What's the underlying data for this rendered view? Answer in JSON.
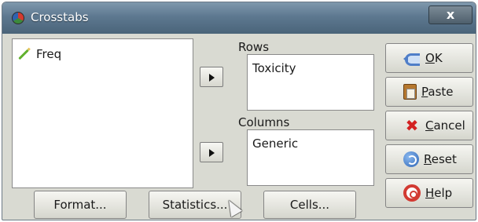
{
  "window": {
    "title": "Crosstabs",
    "close_label": "x"
  },
  "variables": {
    "items": [
      {
        "label": "Freq",
        "icon": "pencil-icon"
      }
    ]
  },
  "rows": {
    "label": "Rows",
    "items": [
      "Toxicity"
    ]
  },
  "columns": {
    "label": "Columns",
    "items": [
      "Generic"
    ]
  },
  "side_buttons": {
    "ok": {
      "mnemonic": "O",
      "rest": "K",
      "icon": "ok-icon"
    },
    "paste": {
      "mnemonic": "P",
      "rest": "aste",
      "icon": "paste-icon"
    },
    "cancel": {
      "mnemonic": "C",
      "rest": "ancel",
      "icon": "cancel-icon"
    },
    "reset": {
      "mnemonic": "R",
      "rest": "eset",
      "icon": "reset-icon"
    },
    "help": {
      "mnemonic": "H",
      "rest": "elp",
      "icon": "help-icon"
    }
  },
  "bottom_buttons": {
    "format": "Format...",
    "statistics": "Statistics...",
    "cells": "Cells..."
  }
}
